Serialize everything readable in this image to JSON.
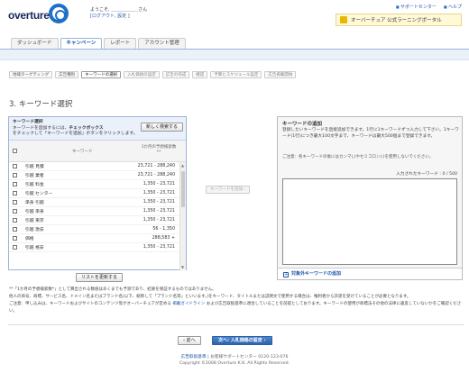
{
  "header": {
    "logo_text": "overture",
    "welcome": "ようこそ, ＿＿＿＿＿＿さん",
    "welcome_links": "[ログアウト, 設定 ]",
    "top_links": [
      "サポートセンター",
      "ヘルプ"
    ],
    "portal": "オーバーチュア 公式ラーニングポータル"
  },
  "tabs": [
    {
      "label": "ダッシュボード",
      "active": false
    },
    {
      "label": "キャンペーン",
      "active": true
    },
    {
      "label": "レポート",
      "active": false
    },
    {
      "label": "アカウント管理",
      "active": false
    }
  ],
  "steps": [
    {
      "label": "地域ターゲティング",
      "state": "done"
    },
    {
      "label": "広告種別",
      "state": "done"
    },
    {
      "label": "キーワードの選択",
      "state": "current"
    },
    {
      "label": "入札価格の設定",
      "state": "todo"
    },
    {
      "label": "広告の作成",
      "state": "todo"
    },
    {
      "label": "確認",
      "state": "todo"
    },
    {
      "label": "予算とスケジュール設定",
      "state": "todo"
    },
    {
      "label": "広告掲載開始",
      "state": "todo"
    }
  ],
  "section": {
    "number": "3.",
    "title": "キーワード選択"
  },
  "left_panel": {
    "title": "キーワード選択",
    "desc_1": "キーワードを追加するには、",
    "desc_bold": "チェックボックス",
    "desc_2": "をチェックして「キーワードを追加」ボタンをクリックします。",
    "new_search": "新しく検索する",
    "col_keyword": "キーワード",
    "col_volume": "1か月の予想検索数**",
    "rows": [
      {
        "keyword": "引越 見積",
        "volume": "23,721 - 288,240"
      },
      {
        "keyword": "引越 業者",
        "volume": "23,721 - 288,240"
      },
      {
        "keyword": "引越 料金",
        "volume": "1,350 - 23,721"
      },
      {
        "keyword": "引越 センター",
        "volume": "1,350 - 23,721"
      },
      {
        "keyword": "単身 引越",
        "volume": "1,350 - 23,721"
      },
      {
        "keyword": "引越 単身",
        "volume": "1,350 - 23,721"
      },
      {
        "keyword": "引越 東京",
        "volume": "1,350 - 23,721"
      },
      {
        "keyword": "引越 激安",
        "volume": "56 - 1,350"
      },
      {
        "keyword": "価格",
        "volume": "288,583 +"
      },
      {
        "keyword": "引越 格安",
        "volume": "1,350 - 23,721"
      }
    ],
    "refresh": "リストを更新する"
  },
  "add_button": "キーワードを追加 ›",
  "right_panel": {
    "title": "キーワードの追加",
    "desc": "登録したいキーワードを直接追加できます。1行に1キーワードずつ入力して下さい。1キーワード(1行)につき最大100文字まで、キーワードは最大500個まで登録できます。",
    "note": "ご注意：各キーワードの後にはカンマ(,)やセミコロン(;)を使用しないでください。",
    "count": "入力されたキーワード : 0 / 500",
    "footer_link": "対象外キーワードの追加"
  },
  "notes": [
    "**「1か月の予想検索数*」として算出される数値はあくまでも予測であり、結果を保証するものではありません。",
    "他人の商号、商標、サービス名、ドメイン名またはブランド名(以下、総称して「ブランド名等」といいます。)をキーワード、タイトルまたは説明文で使用する場合は、権利者から許諾を受けていることが必要となります。",
    "ご注意：申し込みは、キーワードおよびサイトのコンテンツ等がオーバーチュアが定める",
    "掲載ガイドライン",
    "および広告取扱基準に適合していることを前提としております。キーワードの使用が商標法その他の法律に違反していないかをご確認ください。"
  ],
  "nav": {
    "back": "‹ 前へ",
    "next": "次へ: 入札価格の設定 ›"
  },
  "footer": {
    "line1_a": "広告取扱基準",
    "line1_b": "| お客様サポートセンター 0120-123-076",
    "line2": "Copyright ©2008 Overture K.K. All Rights Reserved."
  }
}
